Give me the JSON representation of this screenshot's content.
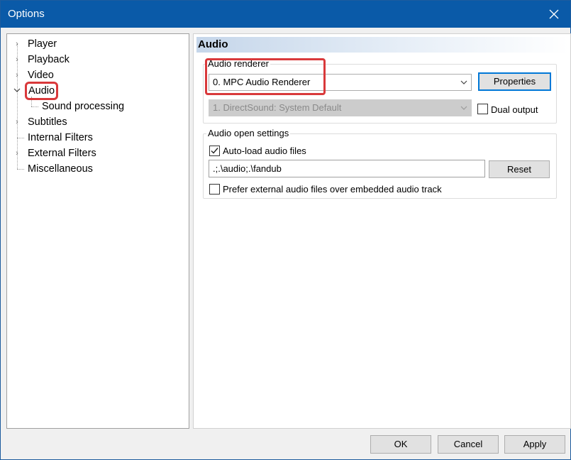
{
  "window": {
    "title": "Options"
  },
  "tree": {
    "items": [
      {
        "label": "Player",
        "expandable": true
      },
      {
        "label": "Playback",
        "expandable": true
      },
      {
        "label": "Video",
        "expandable": true
      },
      {
        "label": "Audio",
        "expandable": true,
        "expanded": true,
        "selected": true
      },
      {
        "label": "Sound processing",
        "child": true
      },
      {
        "label": "Subtitles",
        "expandable": true
      },
      {
        "label": "Internal Filters",
        "expandable": false
      },
      {
        "label": "External Filters",
        "expandable": true
      },
      {
        "label": "Miscellaneous",
        "expandable": false
      }
    ]
  },
  "panel": {
    "title": "Audio",
    "renderer": {
      "group_title": "Audio renderer",
      "primary_value": "0. MPC Audio Renderer",
      "secondary_value": "1. DirectSound: System Default",
      "properties_label": "Properties",
      "dual_output_label": "Dual output",
      "dual_output_checked": false
    },
    "open_settings": {
      "group_title": "Audio open settings",
      "autoload_label": "Auto-load audio files",
      "autoload_checked": true,
      "paths_value": ".;.\\audio;.\\fandub",
      "reset_label": "Reset",
      "prefer_external_label": "Prefer external audio files over embedded audio track",
      "prefer_external_checked": false
    }
  },
  "buttons": {
    "ok": "OK",
    "cancel": "Cancel",
    "apply": "Apply"
  },
  "colors": {
    "titlebar": "#0a5aa8",
    "highlight": "#d9393b",
    "default_button_border": "#0078d7"
  }
}
